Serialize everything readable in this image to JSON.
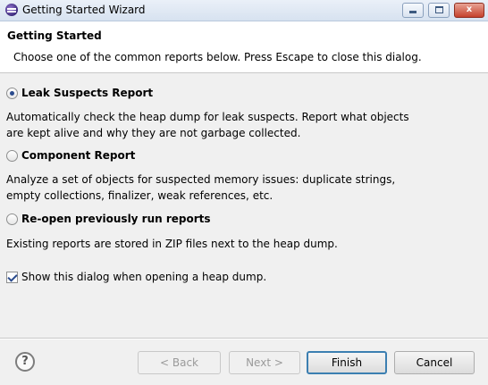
{
  "window": {
    "title": "Getting Started Wizard",
    "controls": {
      "close_label": "x"
    }
  },
  "header": {
    "title": "Getting Started",
    "description": "Choose one of the common reports below. Press Escape to close this dialog."
  },
  "options": [
    {
      "label": "Leak Suspects Report",
      "selected": true,
      "description_lines": [
        "Automatically check the heap dump for leak suspects. Report what objects",
        "are kept alive and why they are not garbage collected."
      ]
    },
    {
      "label": "Component Report",
      "selected": false,
      "description_lines": [
        "Analyze a set of objects for suspected memory issues: duplicate strings,",
        "empty collections, finalizer, weak references, etc."
      ]
    },
    {
      "label": "Re-open previously run reports",
      "selected": false,
      "description_lines": [
        "Existing reports are stored in ZIP files next to the heap dump."
      ]
    }
  ],
  "show_dialog": {
    "label": "Show this dialog when opening a heap dump.",
    "checked": true
  },
  "footer": {
    "help_glyph": "?",
    "back_label": "< Back",
    "next_label": "Next >",
    "finish_label": "Finish",
    "cancel_label": "Cancel"
  }
}
